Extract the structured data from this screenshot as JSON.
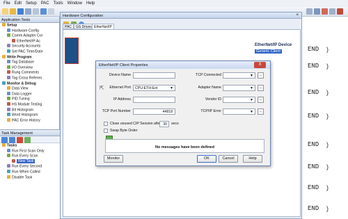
{
  "menubar": [
    "File",
    "Edit",
    "Setup",
    "PAC",
    "Tools",
    "Window",
    "Help"
  ],
  "app_tools": {
    "title": "Application Tools",
    "items": [
      {
        "label": "Setup",
        "level": 0,
        "bold": true,
        "icon": "setup-folder-icon"
      },
      {
        "label": "Hardware Config",
        "level": 1,
        "icon": "hardware-icon"
      },
      {
        "label": "Comm Adapter Cor",
        "level": 1,
        "icon": "adapter-icon"
      },
      {
        "label": "EtherNet/IP Ac",
        "level": 2,
        "icon": "ethernet-icon"
      },
      {
        "label": "Security Accounts",
        "level": 1,
        "icon": "security-icon"
      },
      {
        "label": "Set PAC Time/Date",
        "level": 1,
        "icon": "clock-icon"
      },
      {
        "label": "Write Program",
        "level": 0,
        "bold": true,
        "icon": "program-folder-icon"
      },
      {
        "label": "Tag Database",
        "level": 1,
        "icon": "database-icon"
      },
      {
        "label": "I/O Overview",
        "level": 1,
        "icon": "io-icon"
      },
      {
        "label": "Rung Comments",
        "level": 1,
        "icon": "comments-icon"
      },
      {
        "label": "Tag Cross Referen",
        "level": 1,
        "icon": "crossref-icon"
      },
      {
        "label": "Monitor & Debug",
        "level": 0,
        "bold": true,
        "icon": "monitor-folder-icon"
      },
      {
        "label": "Data View",
        "level": 1,
        "icon": "dataview-icon"
      },
      {
        "label": "Data Logger",
        "level": 1,
        "icon": "logger-icon"
      },
      {
        "label": "PID Tuning",
        "level": 1,
        "icon": "pid-icon"
      },
      {
        "label": "HS Module Testing",
        "level": 1,
        "icon": "module-icon"
      },
      {
        "label": "Bit Histogram",
        "level": 1,
        "icon": "histogram-icon"
      },
      {
        "label": "Word Histogram",
        "level": 1,
        "icon": "histogram-icon"
      },
      {
        "label": "PAC Error History",
        "level": 1,
        "icon": "error-icon"
      }
    ]
  },
  "task_mgmt": {
    "title": "Task Management",
    "items": [
      {
        "label": "Tasks",
        "level": 0,
        "bold": true
      },
      {
        "label": "Run First Scan Only",
        "level": 1
      },
      {
        "label": "Run Every Scan",
        "level": 1
      },
      {
        "label": "New Task",
        "level": 2,
        "selected": true
      },
      {
        "label": "Run Every Second",
        "level": 1
      },
      {
        "label": "Run When Called",
        "level": 1
      },
      {
        "label": "Disable Task",
        "level": 1
      }
    ]
  },
  "hw": {
    "title": "Hardware Configuration",
    "close": "×",
    "tabs": [
      "PAC",
      "GS Drives",
      "EtherNet/IP"
    ],
    "device_title": "EtherNet/IP Device",
    "device_client": "Generic Client"
  },
  "dialog": {
    "title": "EtherNet/IP Client Properties",
    "close": "X",
    "device_name_label": "Device Name",
    "device_name_value": "",
    "ethernet_port_label": "Ethernet Port",
    "ethernet_port_value": "CPU-ETH-Ext",
    "ip_label": "IP Address",
    "ip_value": "",
    "tcp_port_label": "TCP Port Number",
    "tcp_port_value": "44818",
    "tcp_connected_label": "TCP Connected",
    "tcp_connected_value": "",
    "adapter_name_label": "Adapter Name",
    "adapter_name_value": "",
    "vendor_id_label": "Vendor ID",
    "vendor_id_value": "",
    "tcpip_error_label": "TCP/IP Error",
    "tcpip_error_value": "",
    "close_unused_label": "Close unused CIP Session after",
    "close_unused_value": "30",
    "close_unused_unit": "secs",
    "swap_byte_label": "Swap Byte Order",
    "ellipsis": "...",
    "message": "No messages have been defined",
    "monitor_button": "Monitor",
    "ok_button": "OK",
    "cancel_button": "Cancel",
    "help_button": "Help"
  },
  "code_rows": [
    {
      "keyword": "END",
      "bracket": ")"
    },
    {
      "keyword": "END",
      "bracket": ")"
    },
    {
      "keyword": "END",
      "bracket": ")"
    },
    {
      "keyword": "END",
      "bracket": ")"
    },
    {
      "keyword": "END",
      "bracket": ")"
    },
    {
      "keyword": "END",
      "bracket": ")"
    },
    {
      "keyword": "END",
      "bracket": ")"
    },
    {
      "keyword": "END",
      "bracket": ")"
    }
  ]
}
